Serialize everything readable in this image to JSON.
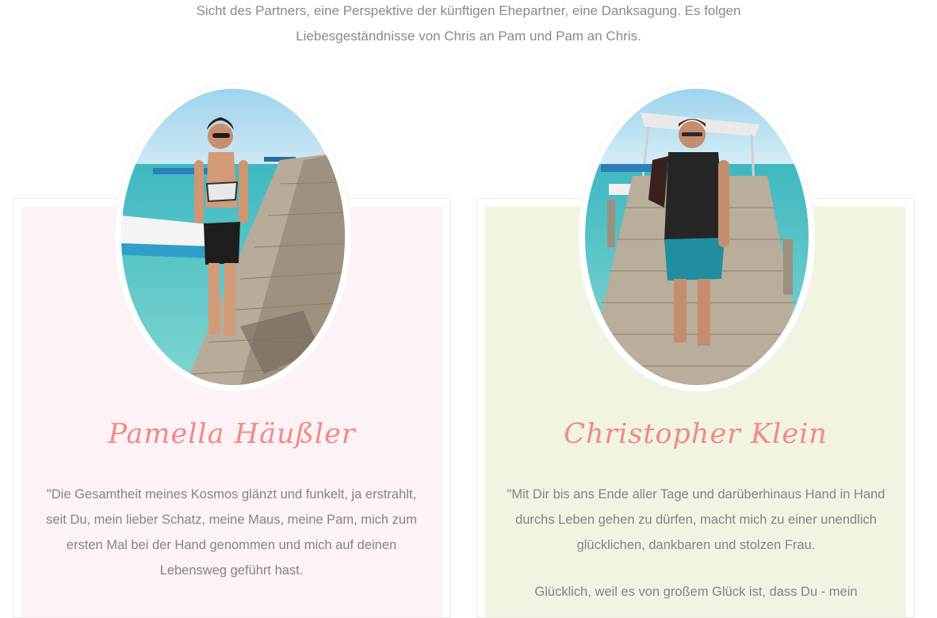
{
  "intro": {
    "line1": "Sicht des Partners, eine Perspektive der künftigen Ehepartner, eine Danksagung. Es folgen",
    "line2": "Liebesgeständnisse von Chris an Pam und Pam an Chris."
  },
  "profiles": [
    {
      "name": "Pamella Häußler",
      "card_color": "#fdf2f5",
      "quote_paragraphs": [
        "\"Die Gesamtheit meines Kosmos glänzt und funkelt, ja erstrahlt, seit Du, mein lieber Schatz, meine Maus, meine Pam, mich zum ersten Mal bei der Hand genommen und mich auf deinen Lebensweg geführt hast."
      ]
    },
    {
      "name": "Christopher Klein",
      "card_color": "#f1f4e1",
      "quote_paragraphs": [
        "\"Mit Dir bis ans Ende aller Tage und darüberhinaus Hand in Hand durchs Leben gehen zu dürfen, macht mich zu einer unendlich glücklichen, dankbaren und stolzen Frau.",
        "Glücklich, weil es von großem Glück ist, dass Du - mein"
      ]
    }
  ],
  "accent_color": "#f08a86"
}
